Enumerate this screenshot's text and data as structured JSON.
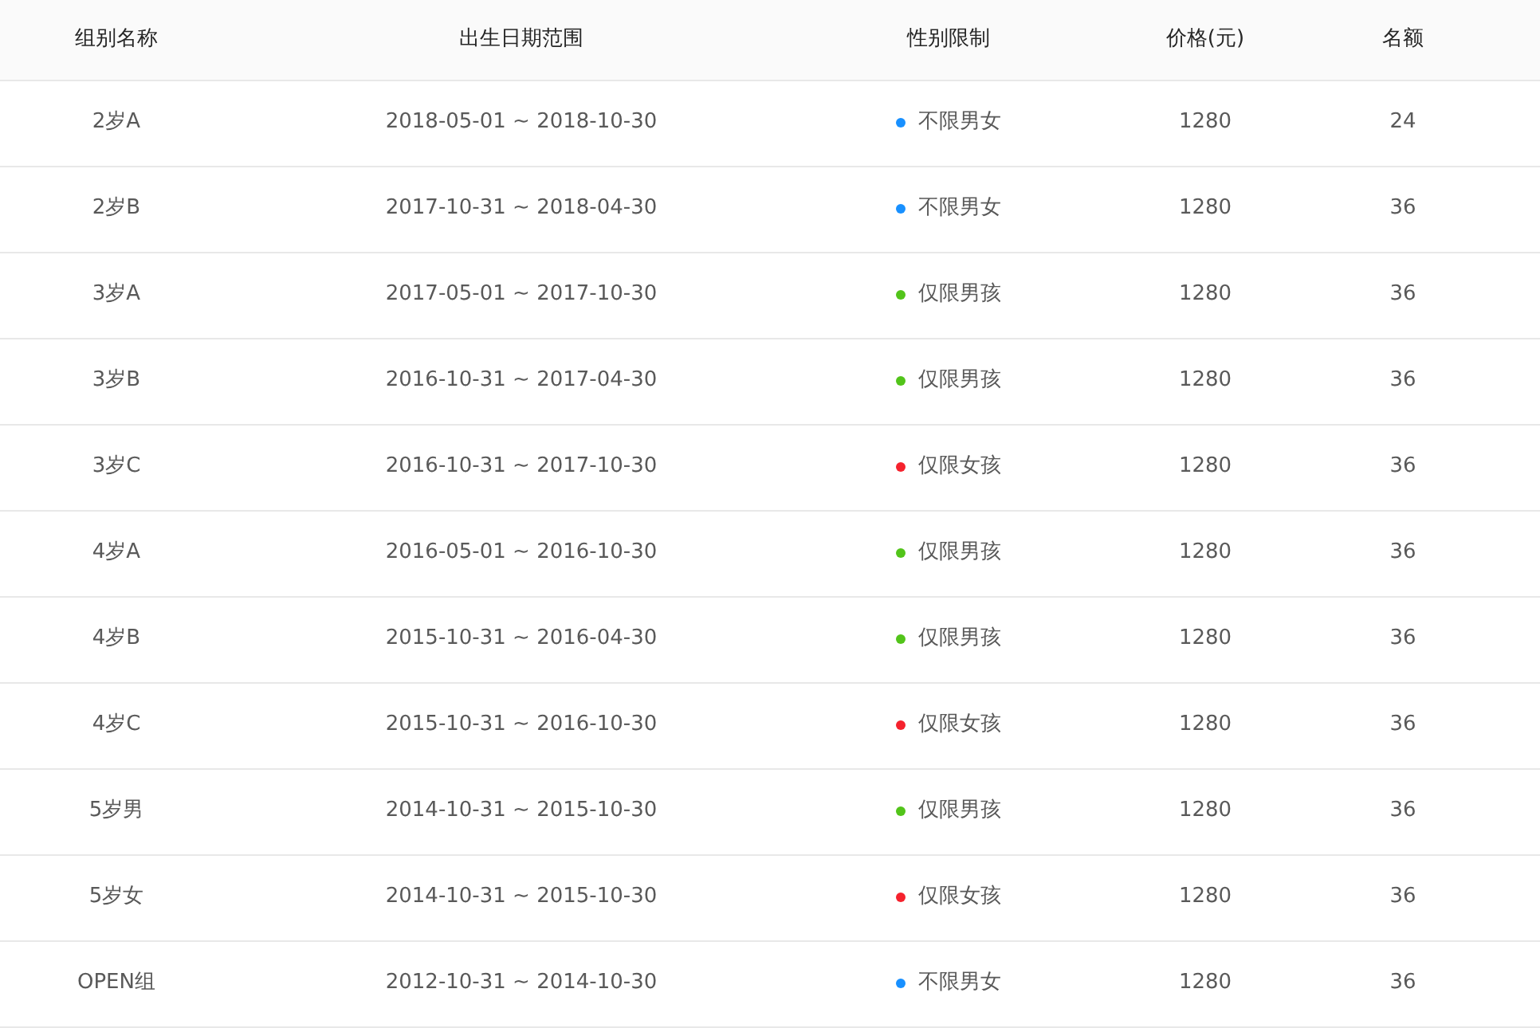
{
  "table": {
    "columns": [
      "组别名称",
      "出生日期范围",
      "性别限制",
      "价格(元)",
      "名额"
    ],
    "rows": [
      {
        "group": "2岁A",
        "dates": "2018-05-01 ~ 2018-10-30",
        "gender": "不限男女",
        "color": "#1890ff",
        "price": "1280",
        "quota": "24"
      },
      {
        "group": "2岁B",
        "dates": "2017-10-31 ~ 2018-04-30",
        "gender": "不限男女",
        "color": "#1890ff",
        "price": "1280",
        "quota": "36"
      },
      {
        "group": "3岁A",
        "dates": "2017-05-01 ~ 2017-10-30",
        "gender": "仅限男孩",
        "color": "#52c41a",
        "price": "1280",
        "quota": "36"
      },
      {
        "group": "3岁B",
        "dates": "2016-10-31 ~ 2017-04-30",
        "gender": "仅限男孩",
        "color": "#52c41a",
        "price": "1280",
        "quota": "36"
      },
      {
        "group": "3岁C",
        "dates": "2016-10-31 ~ 2017-10-30",
        "gender": "仅限女孩",
        "color": "#f5222d",
        "price": "1280",
        "quota": "36"
      },
      {
        "group": "4岁A",
        "dates": "2016-05-01 ~ 2016-10-30",
        "gender": "仅限男孩",
        "color": "#52c41a",
        "price": "1280",
        "quota": "36"
      },
      {
        "group": "4岁B",
        "dates": "2015-10-31 ~ 2016-04-30",
        "gender": "仅限男孩",
        "color": "#52c41a",
        "price": "1280",
        "quota": "36"
      },
      {
        "group": "4岁C",
        "dates": "2015-10-31 ~ 2016-10-30",
        "gender": "仅限女孩",
        "color": "#f5222d",
        "price": "1280",
        "quota": "36"
      },
      {
        "group": "5岁男",
        "dates": "2014-10-31 ~ 2015-10-30",
        "gender": "仅限男孩",
        "color": "#52c41a",
        "price": "1280",
        "quota": "36"
      },
      {
        "group": "5岁女",
        "dates": "2014-10-31 ~ 2015-10-30",
        "gender": "仅限女孩",
        "color": "#f5222d",
        "price": "1280",
        "quota": "36"
      },
      {
        "group": "OPEN组",
        "dates": "2012-10-31 ~ 2014-10-30",
        "gender": "不限男女",
        "color": "#1890ff",
        "price": "1280",
        "quota": "36"
      }
    ]
  }
}
